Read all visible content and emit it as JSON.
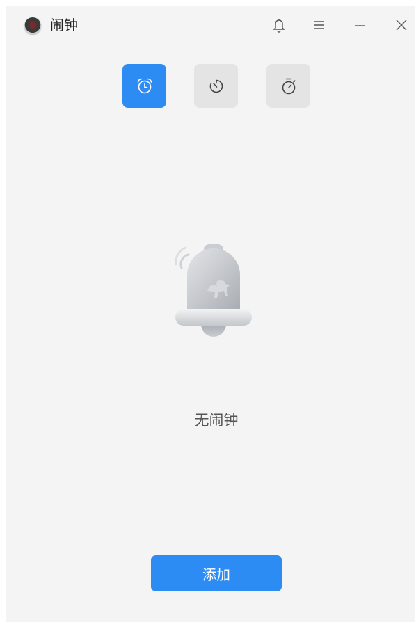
{
  "window": {
    "title": "闹钟"
  },
  "titlebar": {
    "app_icon": "clock-app-icon",
    "buttons": [
      "bell-icon",
      "menu-icon",
      "minimize-icon",
      "close-icon"
    ]
  },
  "tabs": [
    {
      "icon": "alarm-clock-icon",
      "active": true
    },
    {
      "icon": "timer-icon",
      "active": false
    },
    {
      "icon": "stopwatch-icon",
      "active": false
    }
  ],
  "main": {
    "illustration": "bell-illustration",
    "empty_text": "无闹钟"
  },
  "footer": {
    "add_label": "添加"
  },
  "colors": {
    "accent": "#2c8cf4",
    "background": "#f4f4f4",
    "tab_inactive": "#e4e4e4",
    "text_muted": "#555555"
  }
}
